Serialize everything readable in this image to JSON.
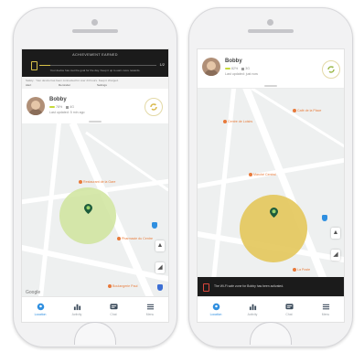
{
  "colors": {
    "accent": "#d9b84a",
    "zone_green": "#cfe49c",
    "zone_yellow": "#e3c75a",
    "dark_bar": "#1b1b1b",
    "tab_active": "#2f8fe0"
  },
  "left": {
    "banner": {
      "title": "ACHIEVEMENT EARNED",
      "line": "Your device has met the goal for the day. Keep it up to earn more rewards.",
      "counter": "1/2"
    },
    "notice": {
      "text": "Safety · Your device has been connected for over 24 hours. Keep it charged.",
      "tags": [
        "Alert",
        "Reminder",
        "Settings"
      ]
    },
    "profile": {
      "name": "Bobby",
      "battery": "78%",
      "signal": "4G",
      "updated": "Last updated: 5 min ago"
    },
    "map": {
      "pois": [
        {
          "label": "Restaurant de la Gare"
        },
        {
          "label": "Pharmacie du Centre"
        },
        {
          "label": "Boulangerie Paul"
        }
      ],
      "brand": "Google"
    }
  },
  "right": {
    "profile": {
      "name": "Bobby",
      "battery": "82%",
      "signal": "3G",
      "updated": "Last updated: just now"
    },
    "map": {
      "pois": [
        {
          "label": "Centre de Loisirs"
        },
        {
          "label": "Café de la Place"
        },
        {
          "label": "Marché Central"
        },
        {
          "label": "La Poste"
        }
      ]
    },
    "toast": {
      "text": "The Wi-Fi safe zone for Bobby has been activated."
    }
  },
  "tabs": [
    {
      "label": "Location",
      "icon": "location-pin-icon"
    },
    {
      "label": "Activity",
      "icon": "bar-chart-icon"
    },
    {
      "label": "Chat",
      "icon": "chat-icon"
    },
    {
      "label": "Menu",
      "icon": "menu-icon"
    }
  ]
}
